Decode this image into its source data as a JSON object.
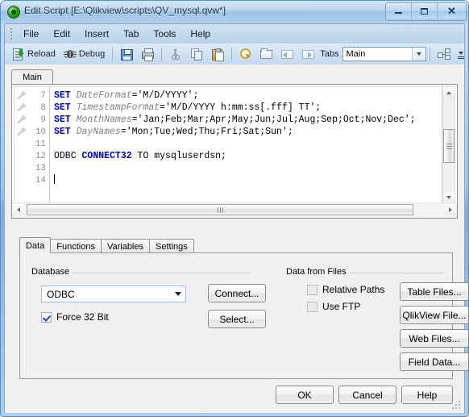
{
  "window": {
    "title": "Edit Script [E:\\Qlikview\\scripts\\QV_mysql.qvw*]",
    "app_icon": "qlikview-logo-icon",
    "controls": {
      "minimize": "Minimize",
      "maximize": "Maximize",
      "close": "Close"
    }
  },
  "menubar": {
    "items": [
      {
        "label": "File"
      },
      {
        "label": "Edit"
      },
      {
        "label": "Insert"
      },
      {
        "label": "Tab"
      },
      {
        "label": "Tools"
      },
      {
        "label": "Help"
      }
    ]
  },
  "toolbar": {
    "reload_label": "Reload",
    "debug_label": "Debug",
    "save_tooltip": "Save",
    "print_tooltip": "Print",
    "cut_tooltip": "Cut",
    "copy_tooltip": "Copy",
    "paste_tooltip": "Paste",
    "find_tooltip": "Find",
    "folder_tooltip": "Open",
    "prev_tooltip": "Previous Tab",
    "next_tooltip": "Next Tab",
    "tabs_label": "Tabs",
    "tabs_value": "Main",
    "organize_tooltip": "Organize Tabs",
    "overflow_tooltip": "Toolbar Options"
  },
  "editor": {
    "tabs": [
      {
        "label": "Main",
        "active": true
      }
    ],
    "lines": [
      {
        "number": "7",
        "marked": true,
        "tokens": [
          {
            "text": "SET ",
            "type": "keyword"
          },
          {
            "text": "DateFormat",
            "type": "variable"
          },
          {
            "text": "='M/D/YYYY';",
            "type": "plain"
          }
        ]
      },
      {
        "number": "8",
        "marked": true,
        "tokens": [
          {
            "text": "SET ",
            "type": "keyword"
          },
          {
            "text": "TimestampFormat",
            "type": "variable"
          },
          {
            "text": "='M/D/YYYY h:mm:ss[.fff] TT';",
            "type": "plain"
          }
        ]
      },
      {
        "number": "9",
        "marked": true,
        "tokens": [
          {
            "text": "SET ",
            "type": "keyword"
          },
          {
            "text": "MonthNames",
            "type": "variable"
          },
          {
            "text": "='Jan;Feb;Mar;Apr;May;Jun;Jul;Aug;Sep;Oct;Nov;Dec';",
            "type": "plain"
          }
        ]
      },
      {
        "number": "10",
        "marked": true,
        "tokens": [
          {
            "text": "SET ",
            "type": "keyword"
          },
          {
            "text": "DayNames",
            "type": "variable"
          },
          {
            "text": "='Mon;Tue;Wed;Thu;Fri;Sat;Sun';",
            "type": "plain"
          }
        ]
      },
      {
        "number": "11",
        "marked": false,
        "tokens": []
      },
      {
        "number": "12",
        "marked": false,
        "tokens": [
          {
            "text": "ODBC ",
            "type": "plain"
          },
          {
            "text": "CONNECT32",
            "type": "keyword"
          },
          {
            "text": " TO mysqluserdsn;",
            "type": "plain"
          }
        ]
      },
      {
        "number": "13",
        "marked": false,
        "tokens": []
      },
      {
        "number": "14",
        "marked": false,
        "tokens": [],
        "caret": true
      }
    ],
    "gutter_mark_icon": "wrench-icon",
    "vscroll": {
      "up": "scroll-up",
      "down": "scroll-down"
    },
    "hscroll": {
      "left": "scroll-left",
      "right": "scroll-right"
    }
  },
  "lower_tabs": [
    {
      "label": "Data",
      "active": true
    },
    {
      "label": "Functions",
      "active": false
    },
    {
      "label": "Variables",
      "active": false
    },
    {
      "label": "Settings",
      "active": false
    }
  ],
  "data_tab": {
    "database_group": {
      "legend": "Database",
      "combo_value": "ODBC",
      "force32_label": "Force 32 Bit",
      "force32_checked": true,
      "connect_label": "Connect...",
      "select_label": "Select..."
    },
    "files_group": {
      "legend": "Data from Files",
      "relative_paths_label": "Relative Paths",
      "relative_paths_checked": false,
      "use_ftp_label": "Use FTP",
      "use_ftp_checked": false,
      "buttons": [
        {
          "label": "Table Files..."
        },
        {
          "label": "QlikView File..."
        },
        {
          "label": "Web Files..."
        },
        {
          "label": "Field Data..."
        }
      ]
    }
  },
  "dialog_buttons": [
    {
      "label": "OK"
    },
    {
      "label": "Cancel"
    },
    {
      "label": "Help"
    }
  ],
  "colors": {
    "keyword": "#0000c8",
    "variable": "#808080",
    "title_text": "#18334d",
    "panel_bg": "#f0f0f0"
  }
}
